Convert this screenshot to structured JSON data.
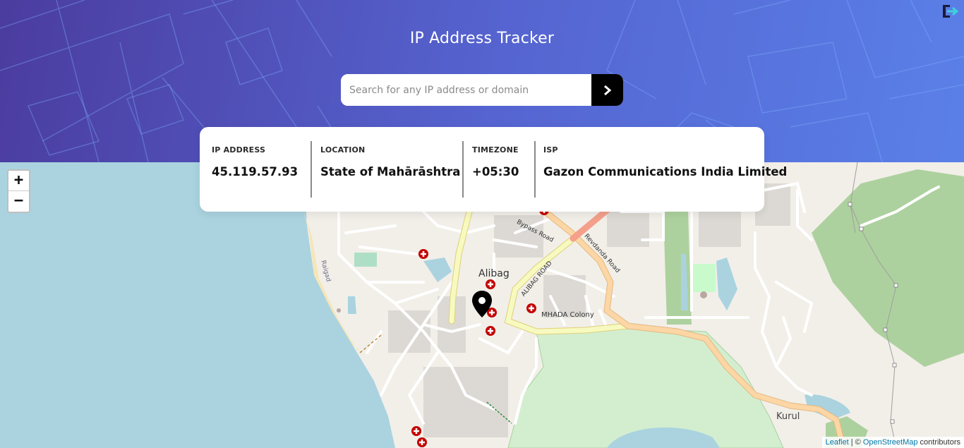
{
  "header": {
    "title": "IP Address Tracker",
    "search": {
      "placeholder": "Search for any IP address or domain",
      "value": ""
    },
    "submit_icon": "chevron-right-icon",
    "brand_icon": "brand-logo-icon"
  },
  "info": {
    "ip": {
      "label": "IP ADDRESS",
      "value": "45.119.57.93"
    },
    "location": {
      "label": "LOCATION",
      "value": "State of Mahārāshtra"
    },
    "timezone": {
      "label": "TIMEZONE",
      "value": "+05:30"
    },
    "isp": {
      "label": "ISP",
      "value": "Gazon Communications India Limited"
    }
  },
  "map": {
    "zoom_in": "+",
    "zoom_out": "−",
    "labels": {
      "city": "Alibag",
      "bypass_road": "Bypass Road",
      "alibag_road": "ALIBAG ROAD",
      "revdanda_road": "Revdanda Road",
      "mhada": "MHADA Colony",
      "raigad": "Raigad",
      "kurul": "Kurul"
    },
    "attribution": {
      "leaflet": "Leaflet",
      "separator": " | © ",
      "osm": "OpenStreetMap",
      "suffix": " contributors"
    }
  },
  "colors": {
    "header_start": "#4b3c9f",
    "header_end": "#5a80e8",
    "sea": "#aad3df",
    "land": "#f2efe9",
    "forest": "#add19e",
    "wetland": "#d3eecf",
    "primary_road": "#fcd6a4",
    "secondary_road": "#f7fabf"
  }
}
